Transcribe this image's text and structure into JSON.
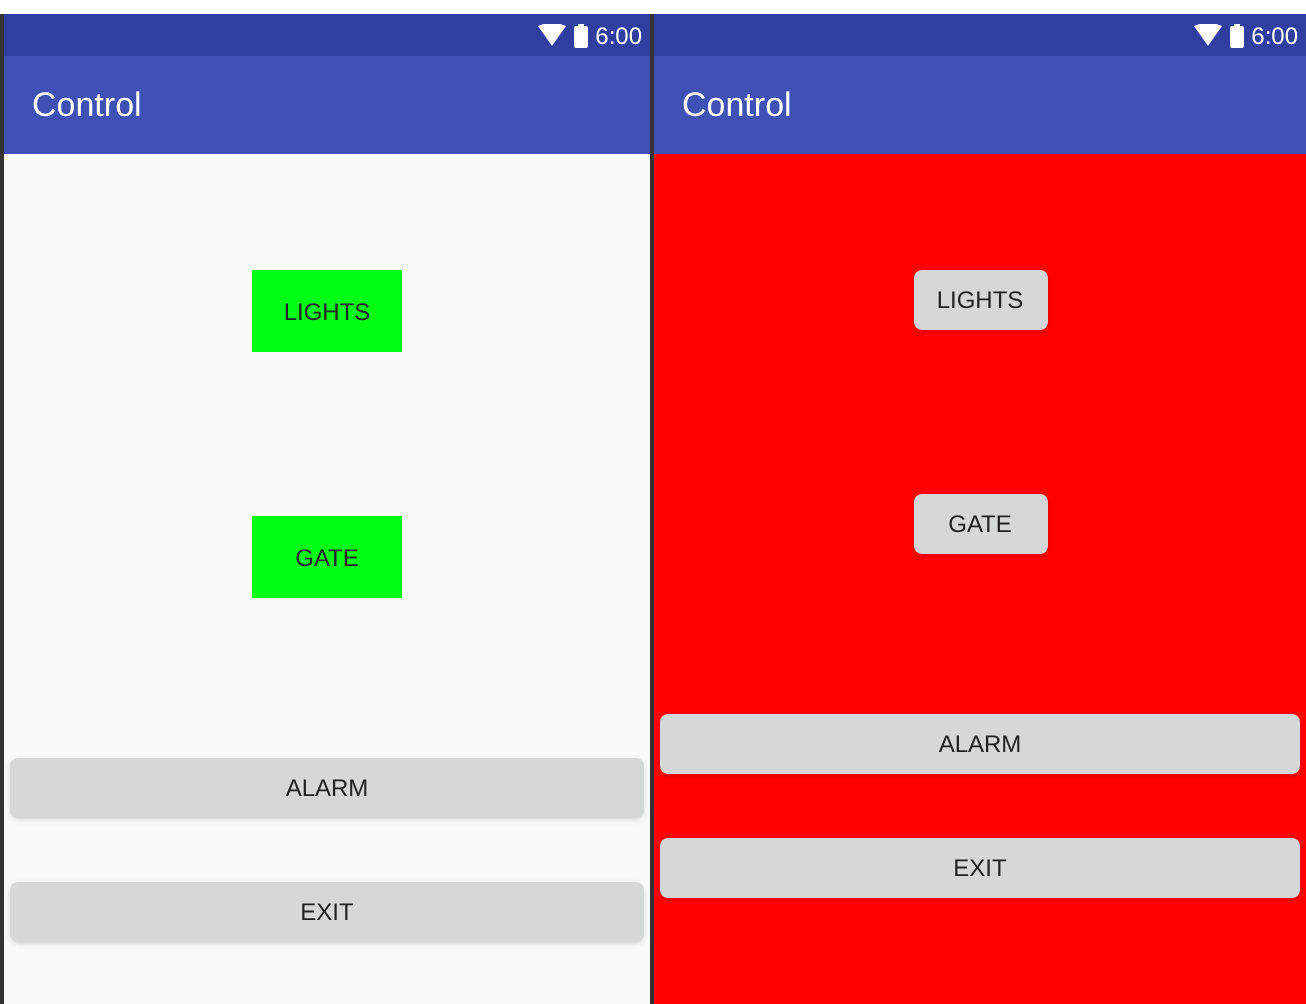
{
  "screens": [
    {
      "status_time": "6:00",
      "title": "Control",
      "color": "#fafafa",
      "buttons": [
        {
          "label": "LIGHTS",
          "kind": "small",
          "on": true
        },
        {
          "label": "GATE",
          "kind": "small",
          "on": true
        },
        {
          "label": "ALARM",
          "kind": "wide",
          "on": false
        },
        {
          "label": "EXIT",
          "kind": "wide",
          "on": false
        }
      ]
    },
    {
      "status_time": "6:00",
      "title": "Control",
      "color": "#ff0000",
      "buttons": [
        {
          "label": "LIGHTS",
          "kind": "small",
          "on": false
        },
        {
          "label": "GATE",
          "kind": "small",
          "on": false
        },
        {
          "label": "ALARM",
          "kind": "wide",
          "on": false
        },
        {
          "label": "EXIT",
          "kind": "wide",
          "on": false
        }
      ]
    }
  ]
}
